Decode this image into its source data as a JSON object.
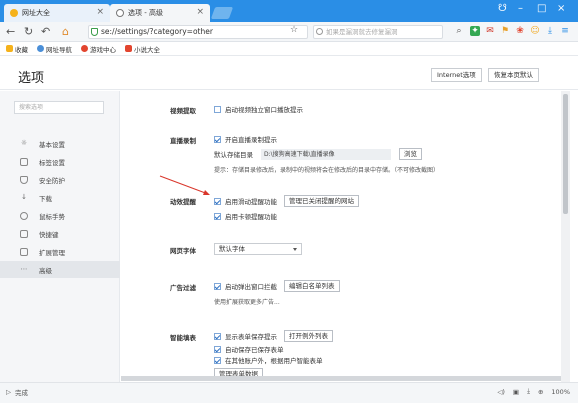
{
  "tabs": [
    {
      "title": "网址大全",
      "close": "×"
    },
    {
      "title": "选项 - 高级",
      "close": "×"
    }
  ],
  "window_controls": {
    "skin": "☋",
    "minimize": "–",
    "maximize": "□",
    "close": "×"
  },
  "address": {
    "url": "se://settings/?category=other",
    "search_placeholder": "如果是漏洞就去修复漏洞"
  },
  "bookmarks": [
    {
      "label": "收藏",
      "color": "#f5b21b"
    },
    {
      "label": "网址导航",
      "color": "#4a8fd8"
    },
    {
      "label": "游戏中心",
      "color": "#e2452f"
    },
    {
      "label": "小说大全",
      "color": "#e2452f"
    }
  ],
  "header": {
    "title": "选项",
    "internet_options": "Internet选项",
    "restore_defaults": "恢复本页默认"
  },
  "sidebar": {
    "search_placeholder": "搜索选项",
    "items": [
      {
        "label": "基本设置",
        "icon": "☼"
      },
      {
        "label": "标签设置",
        "icon": "▭"
      },
      {
        "label": "安全防护",
        "icon": "◐"
      },
      {
        "label": "下载",
        "icon": "↓"
      },
      {
        "label": "鼠标手势",
        "icon": "☝"
      },
      {
        "label": "快捷键",
        "icon": "⌨"
      },
      {
        "label": "扩展管理",
        "icon": "⊞"
      },
      {
        "label": "高级",
        "icon": "⋯"
      }
    ]
  },
  "sections": {
    "video_capture": {
      "label": "视频提取",
      "option": "启动视频独立窗口播放提示"
    },
    "live_record": {
      "label": "直播录制",
      "option": "开启直播录制提示",
      "default_dir_label": "默认存储目录",
      "default_dir_value": "D:\\搜狗高速下载\\直播录像",
      "browse": "浏览",
      "hint": "提示：存储目录修改后，录制中的视频将会在修改后的目录中存储。（不可修改截图）"
    },
    "page_motion": {
      "label": "动效提醒",
      "option1": "启用滑动提醒功能",
      "manage_sites": "管理已关闭提醒的网站",
      "option2": "启用卡顿提醒功能"
    },
    "page_font": {
      "label": "网页字体",
      "selected": "默认字体"
    },
    "adblock": {
      "label": "广告过滤",
      "option": "启动弹出窗口拦截",
      "edit_filter": "编辑白名单列表",
      "hint": "使用扩展获取更多广告..."
    },
    "forms": {
      "label": "智能填表",
      "option1": "显示表单保存提示",
      "open_list": "打开例外列表",
      "option2": "自动保存已保存表单",
      "option3": "在其他账户外，根据用户智能表单",
      "manage": "管理表单数据"
    }
  },
  "status": {
    "text": "完成",
    "zoom": "100%"
  },
  "colors": {
    "tabbar": "#2a8ee6",
    "arrow": "#d9362b"
  }
}
